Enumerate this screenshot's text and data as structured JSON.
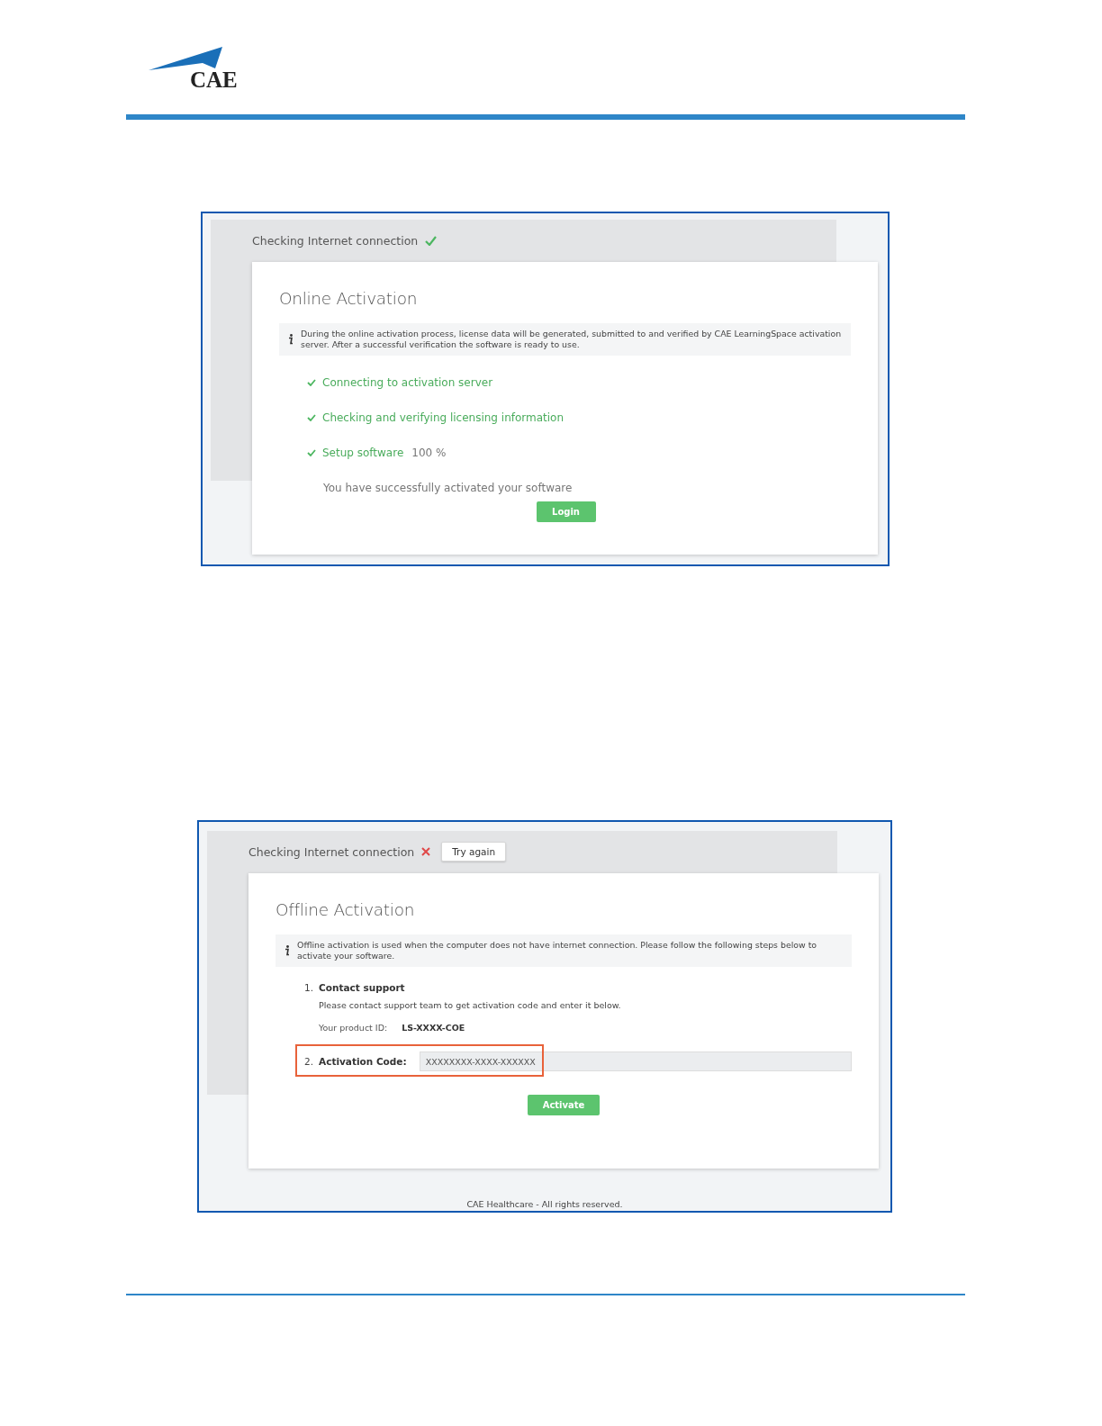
{
  "header": {
    "logo_text": "CAE"
  },
  "screenshots": [
    {
      "kind": "online",
      "status": {
        "label": "Checking Internet connection",
        "connected": true
      },
      "title": "Online Activation",
      "info": "During the online activation process, license data will be generated, submitted to and verified by CAE LearningSpace activation server. After a successful verification the software is ready to use.",
      "steps": [
        {
          "label": "Connecting to activation server",
          "done": true
        },
        {
          "label": "Checking and verifying licensing information",
          "done": true
        },
        {
          "label": "Setup software",
          "done": true,
          "progress": "100 %"
        }
      ],
      "message": "You have successfully activated your software",
      "button": "Login"
    },
    {
      "kind": "offline",
      "status": {
        "label": "Checking Internet connection",
        "connected": false,
        "retry_button": "Try again"
      },
      "title": "Offline Activation",
      "info": "Offline activation is used when the computer does not have internet connection. Please follow the following steps below to activate your software.",
      "steps": [
        {
          "kind": "text",
          "number": "1.",
          "title": "Contact support",
          "description": "Please contact support team to get activation code and enter it below.",
          "product_id_label": "Your product ID:",
          "product_id": "LS-XXXX-COE"
        },
        {
          "kind": "field",
          "number": "2.",
          "title": "Activation Code:",
          "value": "XXXXXXXX-XXXX-XXXXXX",
          "highlighted": true
        }
      ],
      "button": "Activate",
      "footer": "CAE Healthcare - All rights reserved."
    }
  ]
}
